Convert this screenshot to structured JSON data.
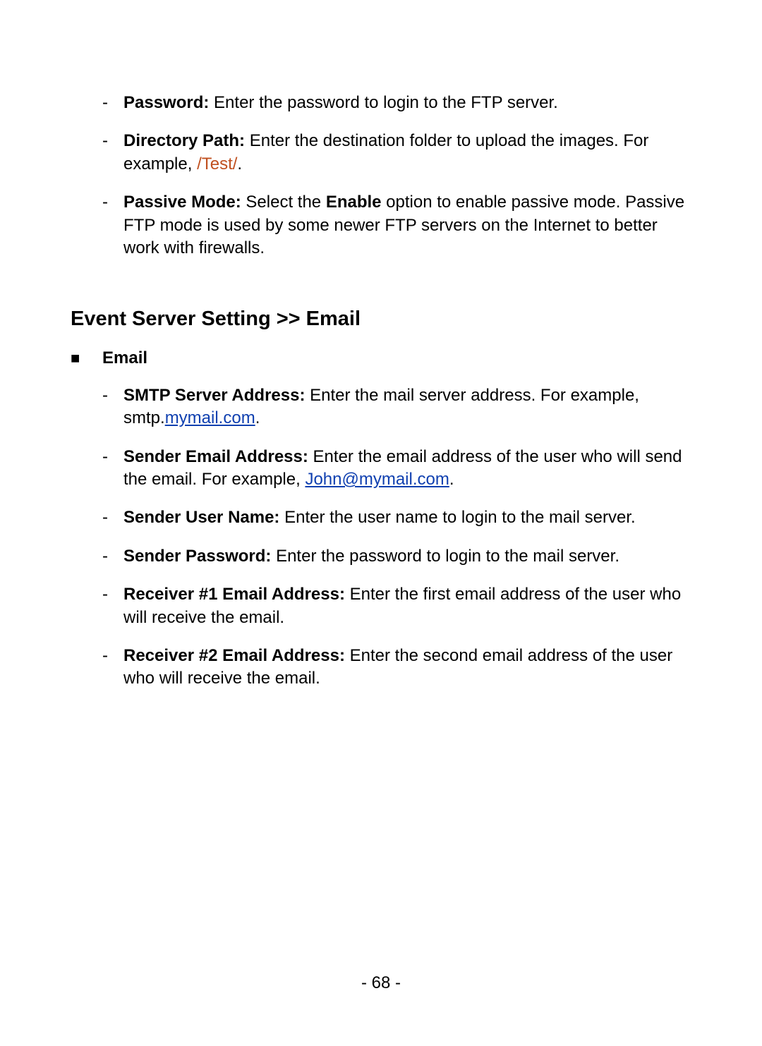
{
  "ftp": {
    "password_label": "Password:",
    "password_text": " Enter the password to login to the FTP server.",
    "directory_path_label": "Directory Path:",
    "directory_path_text_1": " Enter the destination folder to upload the images. For example, ",
    "directory_path_example": "/Test/",
    "directory_path_text_2": ".",
    "passive_mode_label": "Passive Mode:",
    "passive_mode_text_1": " Select the ",
    "passive_mode_enable": "Enable",
    "passive_mode_text_2": " option to enable passive mode. Passive FTP mode is used by some newer FTP servers on the Internet to better work with firewalls."
  },
  "section_heading": "Event Server Setting >> Email",
  "subsection_label": "Email",
  "email": {
    "smtp_label": "SMTP Server Address:",
    "smtp_text_1": " Enter the mail server address. For example, smtp.",
    "smtp_link": "mymail.com",
    "smtp_text_2": ".",
    "sender_email_label": "Sender Email Address:",
    "sender_email_text_1": " Enter the email address of the user who will send the email. For example, ",
    "sender_email_link": "John@mymail.com",
    "sender_email_text_2": ".",
    "sender_user_label": "Sender User Name:",
    "sender_user_text": " Enter the user name to login to the mail server.",
    "sender_password_label": "Sender Password:",
    "sender_password_text": " Enter the password to login to the mail server.",
    "receiver1_label": "Receiver #1 Email Address:",
    "receiver1_text": " Enter the first email address of the user who will receive the email.",
    "receiver2_label": "Receiver #2 Email Address:",
    "receiver2_text": " Enter the second email address of the user who will receive the email."
  },
  "page_number": "- 68 -"
}
